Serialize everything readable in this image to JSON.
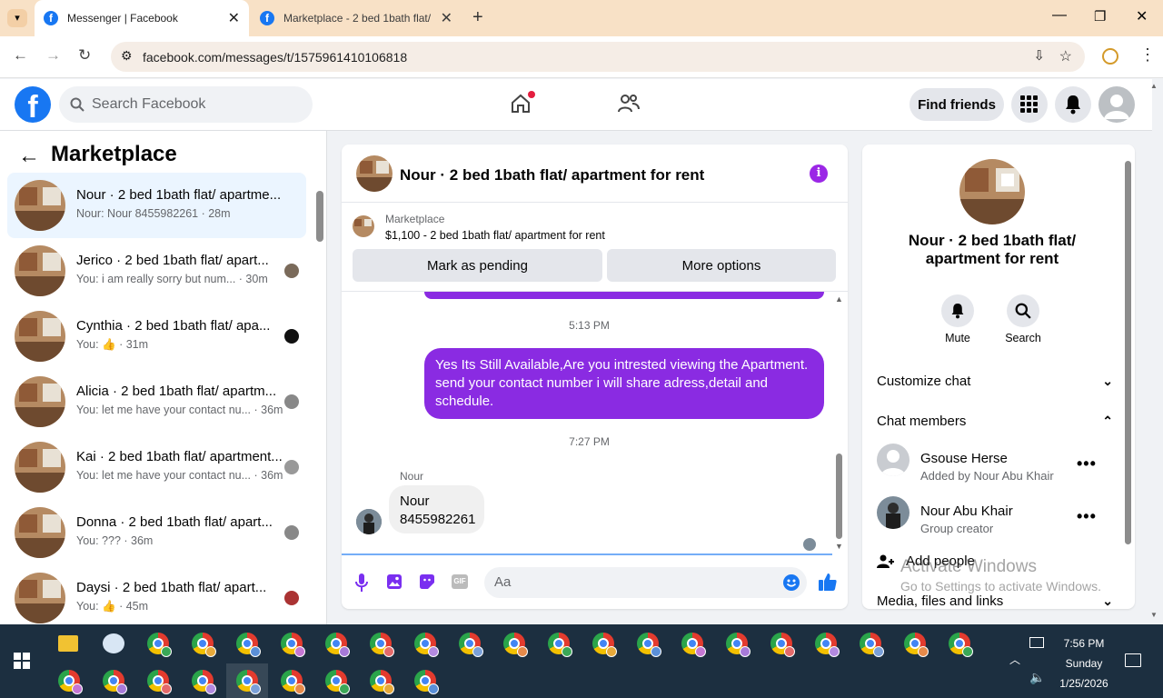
{
  "browser": {
    "tabs": [
      {
        "title": "Messenger | Facebook",
        "active": true
      },
      {
        "title": "Marketplace - 2 bed 1bath flat/",
        "active": false
      }
    ],
    "url": "facebook.com/messages/t/1575961410106818"
  },
  "header": {
    "search_placeholder": "Search Facebook",
    "find_friends": "Find friends"
  },
  "sidebar": {
    "title": "Marketplace",
    "conversations": [
      {
        "name": "Nour · 2 bed 1bath flat/ apartme...",
        "preview": "Nour: Nour 8455982261 · 28m",
        "active": true
      },
      {
        "name": "Jerico · 2 bed 1bath flat/ apart...",
        "preview": "You: i am really sorry but num... · 30m"
      },
      {
        "name": "Cynthia · 2 bed 1bath flat/ apa...",
        "preview": "You: 👍 · 31m"
      },
      {
        "name": "Alicia · 2 bed 1bath flat/ apartm...",
        "preview": "You: let me have your contact nu... · 36m"
      },
      {
        "name": "Kai · 2 bed 1bath flat/ apartment...",
        "preview": "You: let me have your contact nu... · 36m"
      },
      {
        "name": "Donna · 2 bed 1bath flat/ apart...",
        "preview": "You: ??? · 36m"
      },
      {
        "name": "Daysi · 2 bed 1bath flat/ apart...",
        "preview": "You: 👍 · 45m"
      }
    ]
  },
  "chat": {
    "title": "Nour · 2 bed 1bath flat/ apartment for rent",
    "listing_label": "Marketplace",
    "listing_text": "$1,100 - 2 bed 1bath flat/ apartment for rent",
    "mark_pending": "Mark as pending",
    "more_options": "More options",
    "time1": "5:13 PM",
    "out_message": "Yes Its Still Available,Are you intrested viewing the Apartment. send your contact number i will share adress,detail and schedule.",
    "time2": "7:27 PM",
    "sender": "Nour",
    "in_line1": "Nour",
    "in_line2": "8455982261",
    "composer_placeholder": "Aa"
  },
  "details": {
    "title": "Nour · 2 bed 1bath flat/ apartment for rent",
    "mute": "Mute",
    "search": "Search",
    "customize": "Customize chat",
    "members_heading": "Chat members",
    "members": [
      {
        "name": "Gsouse Herse",
        "sub": "Added by Nour Abu Khair"
      },
      {
        "name": "Nour Abu Khair",
        "sub": "Group creator"
      }
    ],
    "add_people": "Add people",
    "media": "Media, files and links",
    "watermark1": "Activate Windows",
    "watermark2": "Go to Settings to activate Windows."
  },
  "taskbar": {
    "time": "7:56 PM",
    "day": "Sunday",
    "date": "1/25/2026"
  }
}
